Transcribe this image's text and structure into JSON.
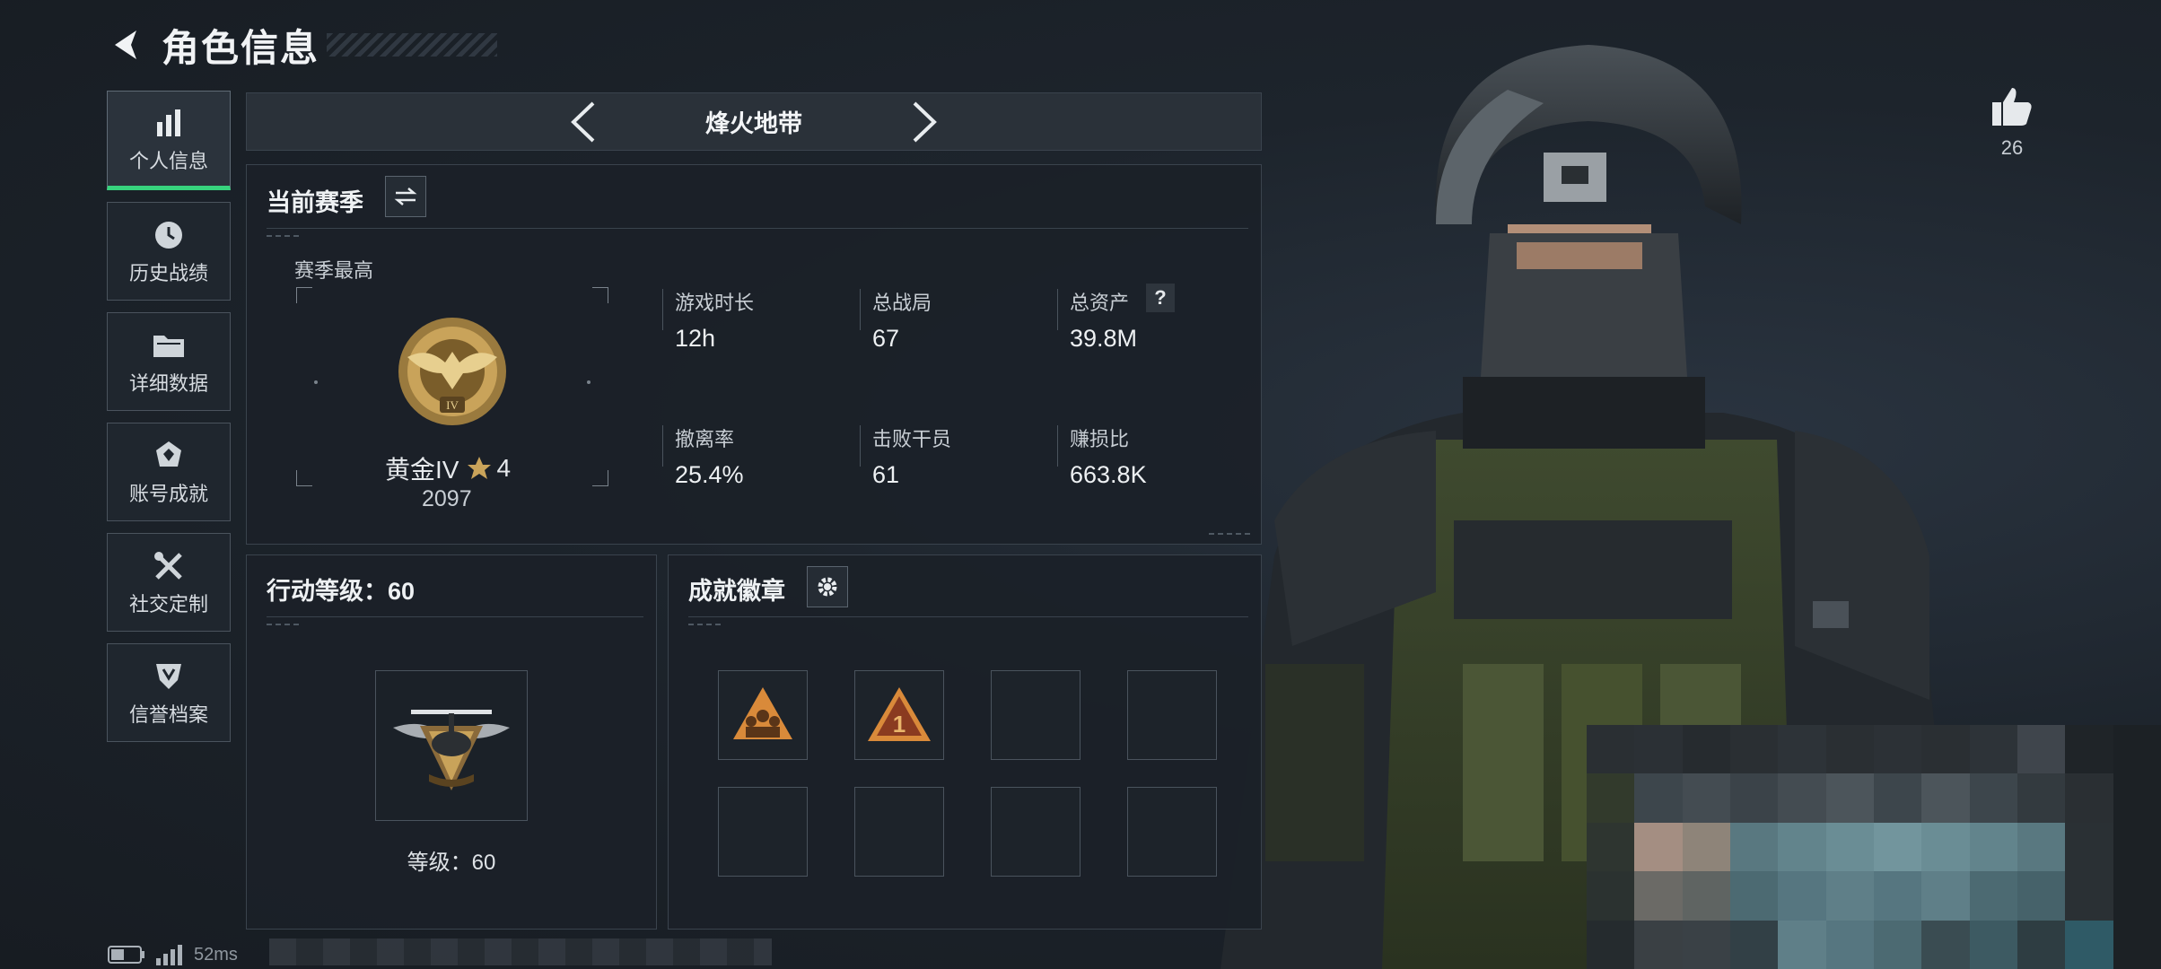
{
  "header": {
    "title": "角色信息"
  },
  "sidebar": {
    "items": [
      {
        "label": "个人信息",
        "icon": "bar-chart-icon",
        "active": true
      },
      {
        "label": "历史战绩",
        "icon": "clock-icon"
      },
      {
        "label": "详细数据",
        "icon": "folder-icon"
      },
      {
        "label": "账号成就",
        "icon": "achievement-icon"
      },
      {
        "label": "社交定制",
        "icon": "tools-icon"
      },
      {
        "label": "信誉档案",
        "icon": "shield-icon"
      }
    ]
  },
  "mode_selector": {
    "current": "烽火地带"
  },
  "season": {
    "title": "当前赛季",
    "best_label": "赛季最高",
    "rank_name": "黄金IV",
    "rank_stars": "4",
    "rank_score": "2097",
    "stats": [
      {
        "label": "游戏时长",
        "value": "12h"
      },
      {
        "label": "总战局",
        "value": "67"
      },
      {
        "label": "总资产",
        "value": "39.8M",
        "help": "?"
      },
      {
        "label": "撤离率",
        "value": "25.4%"
      },
      {
        "label": "击败干员",
        "value": "61"
      },
      {
        "label": "赚损比",
        "value": "663.8K"
      }
    ]
  },
  "action_level": {
    "title": "行动等级：60",
    "level_text": "等级：60"
  },
  "achievements": {
    "title": "成就徽章"
  },
  "likes": {
    "count": "26"
  },
  "status": {
    "ping": "52ms"
  },
  "colors": {
    "accent": "#37d37d",
    "gold": "#c9a35a",
    "badge_orange": "#d98a3a"
  }
}
